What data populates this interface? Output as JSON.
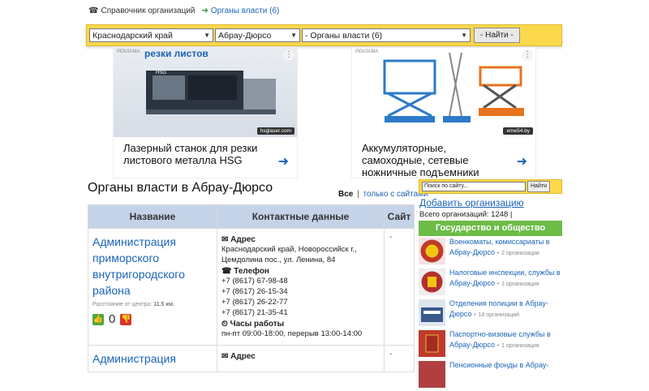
{
  "breadcrumbs": [
    {
      "icon": "phone-icon",
      "label": "Справочник организаций"
    },
    {
      "icon": "arrow-right-icon",
      "label": "Органы власти (6)"
    }
  ],
  "filters": {
    "region": "Краснодарский край",
    "city": "Абрау-Дюрсо",
    "category": "- Органы власти (6)",
    "find_label": "- Найти -"
  },
  "ads": [
    {
      "label": "РЕКЛАМА",
      "headline_top": "резки листов",
      "brand": "HSG",
      "domain": "hsglaser.com",
      "text": "Лазерный станок для резки листового металла HSG"
    },
    {
      "label": "РЕКЛАМА",
      "domain": "eme54.by",
      "text": "Аккумуляторные, самоходные, сетевые ножничные подъемники"
    }
  ],
  "page_title": "Органы власти в Абрау-Дюрсо",
  "view_filter": {
    "all": "Все",
    "sep": "|",
    "with_sites": "только с сайтами"
  },
  "table": {
    "headers": [
      "Название",
      "Контактные данные",
      "Сайт"
    ],
    "rows": [
      {
        "name": "Администрация приморского внутригородского района",
        "distance_label": "Расстояние от центра:",
        "distance_value": "11.5 км.",
        "votes": "0",
        "address_head": "Адрес",
        "address": [
          "Краснодарский край, Новороссийск г.,",
          "Цемдолина пос., ул. Ленина, 84"
        ],
        "phone_head": "Телефон",
        "phones": [
          "+7 (8617) 67-98-48",
          "+7 (8617) 26-15-34",
          "+7 (8617) 26-22-77",
          "+7 (8617) 21-35-41"
        ],
        "hours_head": "Часы работы",
        "hours": "пн-пт 09:00-18:00, перерыв 13:00-14:00",
        "site": "-"
      },
      {
        "name": "Администрация",
        "address_head": "Адрес",
        "site": "-"
      }
    ]
  },
  "sidebar": {
    "search_placeholder": "Поиск по сайту...",
    "search_button": "Найти",
    "add_org": "Добавить организацию",
    "total": "Всего организаций: 1248 |",
    "category_header": "Государство и общество",
    "categories": [
      {
        "label": "Военкоматы, комиссариаты в Абрау-Дюрсо",
        "count": "2 организации",
        "color": "#c0392b"
      },
      {
        "label": "Налоговые инспекции, службы в Абрау-Дюрсо",
        "count": "1 организация",
        "color": "#b33030"
      },
      {
        "label": "Отделения полиции в Абрау-Дюрсо",
        "count": "18 организаций",
        "color": "#3b5a8a"
      },
      {
        "label": "Паспортно-визовые службы в Абрау-Дюрсо",
        "count": "1 организация",
        "color": "#c0392b"
      },
      {
        "label": "Пенсионные фонды в Абрау-",
        "count": "",
        "color": "#b04040"
      }
    ]
  }
}
